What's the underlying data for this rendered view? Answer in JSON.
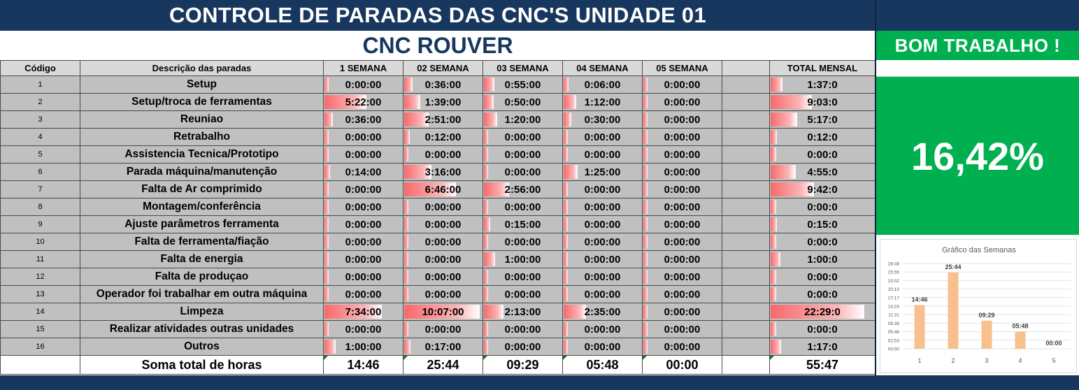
{
  "header": {
    "title": "CONTROLE DE PARADAS DAS CNC'S UNIDADE 01",
    "subtitle": "CNC ROUVER",
    "message": "BOM TRABALHO !"
  },
  "table": {
    "columns": [
      "Código",
      "Descrição das paradas",
      "1 SEMANA",
      "02 SEMANA",
      "03 SEMANA",
      "04 SEMANA",
      "05 SEMANA",
      "",
      "TOTAL MENSAL"
    ],
    "rows": [
      {
        "code": "1",
        "desc": "Setup",
        "w": [
          "0:00:00",
          "0:36:00",
          "0:55:00",
          "0:06:00",
          "0:00:00"
        ],
        "total": "1:37:0"
      },
      {
        "code": "2",
        "desc": "Setup/troca de ferramentas",
        "w": [
          "5:22:00",
          "1:39:00",
          "0:50:00",
          "1:12:00",
          "0:00:00"
        ],
        "total": "9:03:0"
      },
      {
        "code": "3",
        "desc": "Reuniao",
        "w": [
          "0:36:00",
          "2:51:00",
          "1:20:00",
          "0:30:00",
          "0:00:00"
        ],
        "total": "5:17:0"
      },
      {
        "code": "4",
        "desc": "Retrabalho",
        "w": [
          "0:00:00",
          "0:12:00",
          "0:00:00",
          "0:00:00",
          "0:00:00"
        ],
        "total": "0:12:0"
      },
      {
        "code": "5",
        "desc": "Assistencia Tecnica/Prototipo",
        "w": [
          "0:00:00",
          "0:00:00",
          "0:00:00",
          "0:00:00",
          "0:00:00"
        ],
        "total": "0:00:0"
      },
      {
        "code": "6",
        "desc": "Parada máquina/manutenção",
        "w": [
          "0:14:00",
          "3:16:00",
          "0:00:00",
          "1:25:00",
          "0:00:00"
        ],
        "total": "4:55:0"
      },
      {
        "code": "7",
        "desc": "Falta de Ar comprimido",
        "w": [
          "0:00:00",
          "6:46:00",
          "2:56:00",
          "0:00:00",
          "0:00:00"
        ],
        "total": "9:42:0"
      },
      {
        "code": "8",
        "desc": "Montagem/conferência",
        "w": [
          "0:00:00",
          "0:00:00",
          "0:00:00",
          "0:00:00",
          "0:00:00"
        ],
        "total": "0:00:0"
      },
      {
        "code": "9",
        "desc": "Ajuste parâmetros ferramenta",
        "w": [
          "0:00:00",
          "0:00:00",
          "0:15:00",
          "0:00:00",
          "0:00:00"
        ],
        "total": "0:15:0"
      },
      {
        "code": "10",
        "desc": "Falta de ferramenta/fiação",
        "w": [
          "0:00:00",
          "0:00:00",
          "0:00:00",
          "0:00:00",
          "0:00:00"
        ],
        "total": "0:00:0"
      },
      {
        "code": "11",
        "desc": "Falta de energia",
        "w": [
          "0:00:00",
          "0:00:00",
          "1:00:00",
          "0:00:00",
          "0:00:00"
        ],
        "total": "1:00:0"
      },
      {
        "code": "12",
        "desc": "Falta de produçao",
        "w": [
          "0:00:00",
          "0:00:00",
          "0:00:00",
          "0:00:00",
          "0:00:00"
        ],
        "total": "0:00:0"
      },
      {
        "code": "13",
        "desc": "Operador foi trabalhar em outra máquina",
        "w": [
          "0:00:00",
          "0:00:00",
          "0:00:00",
          "0:00:00",
          "0:00:00"
        ],
        "total": "0:00:0"
      },
      {
        "code": "14",
        "desc": "Limpeza",
        "w": [
          "7:34:00",
          "10:07:00",
          "2:13:00",
          "2:35:00",
          "0:00:00"
        ],
        "total": "22:29:0"
      },
      {
        "code": "15",
        "desc": "Realizar atividades outras unidades",
        "w": [
          "0:00:00",
          "0:00:00",
          "0:00:00",
          "0:00:00",
          "0:00:00"
        ],
        "total": "0:00:0"
      },
      {
        "code": "16",
        "desc": "Outros",
        "w": [
          "1:00:00",
          "0:17:00",
          "0:00:00",
          "0:00:00",
          "0:00:00"
        ],
        "total": "1:17:0"
      }
    ],
    "sum_label": "Soma total de horas",
    "sums": [
      "14:46",
      "25:44",
      "09:29",
      "05:48",
      "00:00"
    ],
    "sum_total": "55:47"
  },
  "percentage": "16,42%",
  "colors": {
    "header_bg": "#17375e",
    "accent_green": "#00b050",
    "grid_bg": "#c0c0c0",
    "bar_red": "#f8696b",
    "chart_bar": "#f9c08f",
    "total_bg": "#ffffcc"
  },
  "chart_data": {
    "type": "bar",
    "title": "Gráfico das Semanas",
    "categories": [
      "1",
      "2",
      "3",
      "4",
      "5"
    ],
    "values": [
      14.7667,
      25.7333,
      9.4833,
      5.8,
      0
    ],
    "value_labels": [
      "14:46",
      "25:44",
      "09:29",
      "05:48",
      "00:00"
    ],
    "ytick_labels": [
      "00:00",
      "02:53",
      "05:46",
      "08:38",
      "11:31",
      "14:24",
      "17:17",
      "20:10",
      "23:02",
      "25:55",
      "28:48"
    ],
    "ylim": [
      0,
      28.8
    ],
    "xlabel": "",
    "ylabel": "",
    "grid": true,
    "legend": "none"
  }
}
